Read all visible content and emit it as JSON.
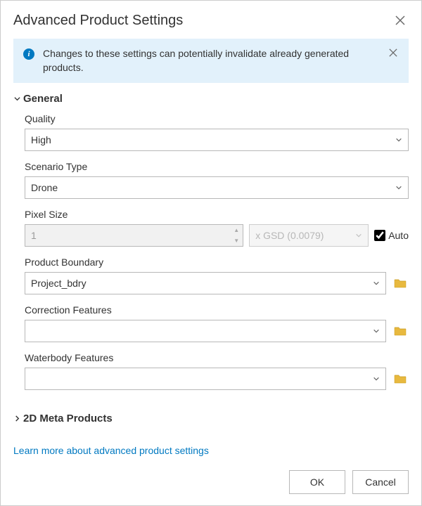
{
  "dialog": {
    "title": "Advanced Product Settings",
    "info_message": "Changes to these settings can potentially invalidate already generated products.",
    "learn_more": "Learn more about advanced product settings",
    "ok_label": "OK",
    "cancel_label": "Cancel"
  },
  "sections": {
    "general": {
      "title": "General",
      "expanded": true,
      "quality": {
        "label": "Quality",
        "value": "High"
      },
      "scenario_type": {
        "label": "Scenario Type",
        "value": "Drone"
      },
      "pixel_size": {
        "label": "Pixel Size",
        "value": "1",
        "gsd_label": "x GSD (0.0079)",
        "auto_label": "Auto",
        "auto_checked": true
      },
      "product_boundary": {
        "label": "Product Boundary",
        "value": "Project_bdry"
      },
      "correction_features": {
        "label": "Correction Features",
        "value": ""
      },
      "waterbody_features": {
        "label": "Waterbody Features",
        "value": ""
      }
    },
    "meta_products": {
      "title": "2D Meta Products",
      "expanded": false
    }
  }
}
